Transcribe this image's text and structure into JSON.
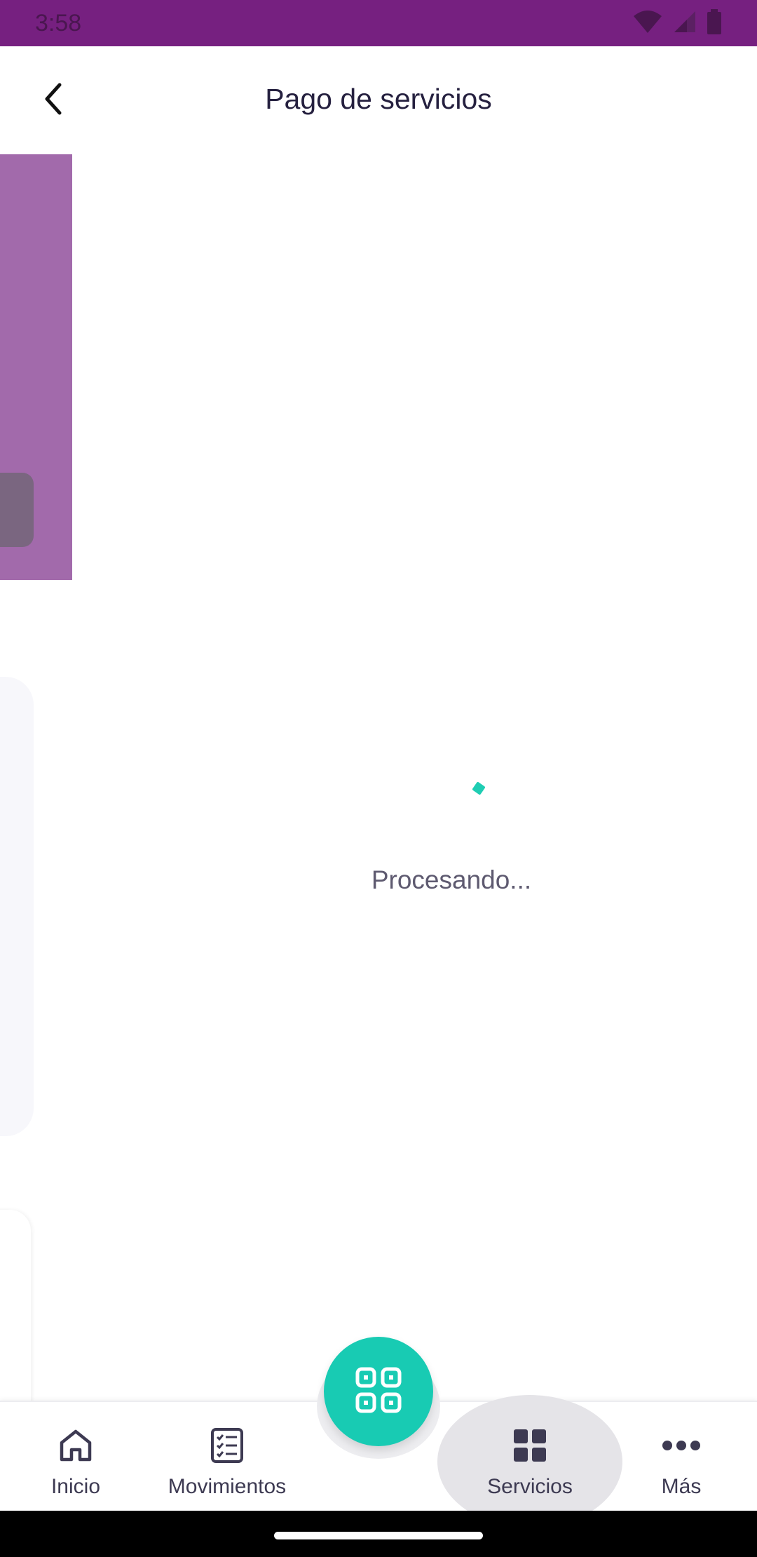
{
  "status_bar": {
    "time": "3:58",
    "icons": [
      "wifi-icon",
      "signal-icon",
      "battery-icon"
    ]
  },
  "header": {
    "title": "Pago de servicios",
    "back_icon": "chevron-left-icon"
  },
  "loading": {
    "text": "Procesando..."
  },
  "bottom_nav": {
    "items": [
      {
        "label": "Inicio",
        "icon": "home-icon"
      },
      {
        "label": "Movimientos",
        "icon": "checklist-icon"
      },
      {
        "label": "Servicios",
        "icon": "grid-icon",
        "selected": true
      },
      {
        "label": "Más",
        "icon": "more-horizontal-icon"
      }
    ],
    "fab_icon": "qr-scan-icon"
  },
  "colors": {
    "status_bar": "#762080",
    "accent_teal": "#18cbb3",
    "purple_card": "#a26aab",
    "title_text": "#25203f",
    "nav_text": "#3d3a52"
  }
}
